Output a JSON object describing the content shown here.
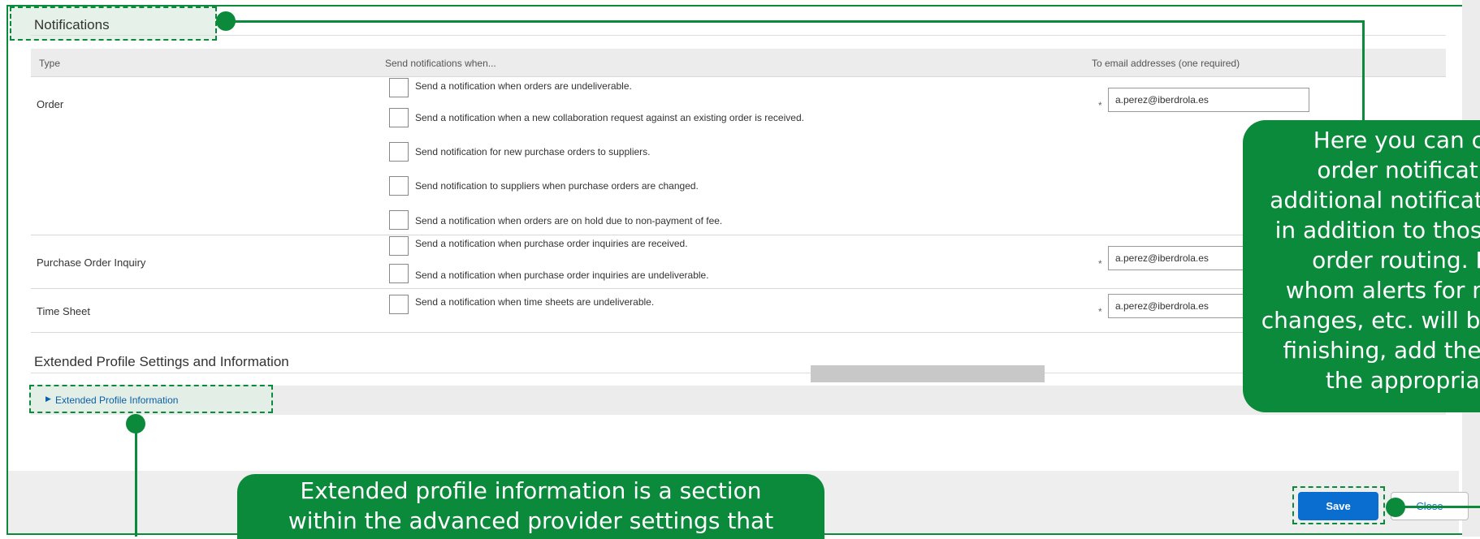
{
  "notifications": {
    "title": "Notifications",
    "columns": {
      "type": "Type",
      "when": "Send notifications when...",
      "emails": "To email addresses (one required)"
    },
    "rows": [
      {
        "label": "Order",
        "email": "a.perez@iberdrola.es",
        "options": [
          "Send a notification when orders are undeliverable.",
          "Send a notification when a new collaboration request against an existing order is received.",
          "Send notification for new purchase orders to suppliers.",
          "Send notification to suppliers when purchase orders are changed.",
          "Send a notification when orders are on hold due to non-payment of fee."
        ]
      },
      {
        "label": "Purchase Order Inquiry",
        "email": "a.perez@iberdrola.es",
        "options": [
          "Send a notification when purchase order inquiries are received.",
          "Send a notification when purchase order inquiries are undeliverable."
        ]
      },
      {
        "label": "Time Sheet",
        "email": "a.perez@iberdrola.es",
        "options": [
          "Send a notification when time sheets are undeliverable."
        ]
      }
    ],
    "required_mark": "*"
  },
  "extended": {
    "title": "Extended Profile Settings and Information",
    "link": "Extended Profile Information"
  },
  "footer": {
    "save": "Save",
    "close": "Close"
  },
  "callouts": {
    "right_lines": [
      "Here you can configure",
      "order notifications and",
      "additional notification contacts",
      "in addition to those defined in",
      "order routing. Define to",
      "whom alerts for new orders,",
      "changes, etc. will be sent. When",
      "finishing, add the email(s) in",
      "the appropriate field."
    ],
    "bottom_lines": [
      "Extended profile information is a section",
      "within the advanced provider settings that"
    ]
  },
  "colors": {
    "accent_green": "#0a8a3a",
    "primary_blue": "#0a6ed1"
  }
}
